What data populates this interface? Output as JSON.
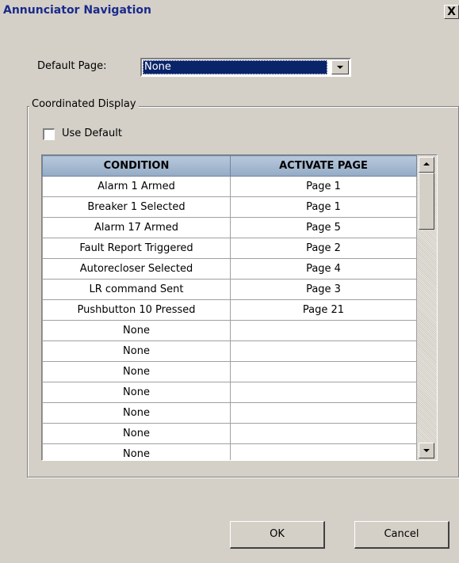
{
  "window": {
    "title": "Annunciator Navigation",
    "close_glyph": "X"
  },
  "default_page": {
    "label": "Default Page:",
    "value": "None"
  },
  "coordinated_display": {
    "legend": "Coordinated Display",
    "use_default_label": "Use Default",
    "use_default_checked": false
  },
  "grid": {
    "columns": [
      "CONDITION",
      "ACTIVATE PAGE"
    ],
    "rows": [
      {
        "condition": "Alarm 1 Armed",
        "page": "Page 1"
      },
      {
        "condition": "Breaker 1 Selected",
        "page": "Page 1"
      },
      {
        "condition": "Alarm 17 Armed",
        "page": "Page 5"
      },
      {
        "condition": "Fault Report Triggered",
        "page": "Page 2"
      },
      {
        "condition": "Autorecloser Selected",
        "page": "Page 4"
      },
      {
        "condition": "LR command Sent",
        "page": "Page 3"
      },
      {
        "condition": "Pushbutton 10 Pressed",
        "page": "Page 21"
      },
      {
        "condition": "None",
        "page": ""
      },
      {
        "condition": "None",
        "page": ""
      },
      {
        "condition": "None",
        "page": ""
      },
      {
        "condition": "None",
        "page": ""
      },
      {
        "condition": "None",
        "page": ""
      },
      {
        "condition": "None",
        "page": ""
      },
      {
        "condition": "None",
        "page": ""
      }
    ]
  },
  "buttons": {
    "ok": "OK",
    "cancel": "Cancel"
  },
  "colors": {
    "dialog_bg": "#d4d0c8",
    "title_text": "#1a2a8a",
    "selection_bg": "#0a246a",
    "header_bg": "#a6bad2"
  },
  "icons": {
    "close": "close-icon",
    "dropdown": "chevron-down-icon",
    "scroll_up": "scroll-up-arrow-icon",
    "scroll_down": "scroll-down-arrow-icon"
  }
}
